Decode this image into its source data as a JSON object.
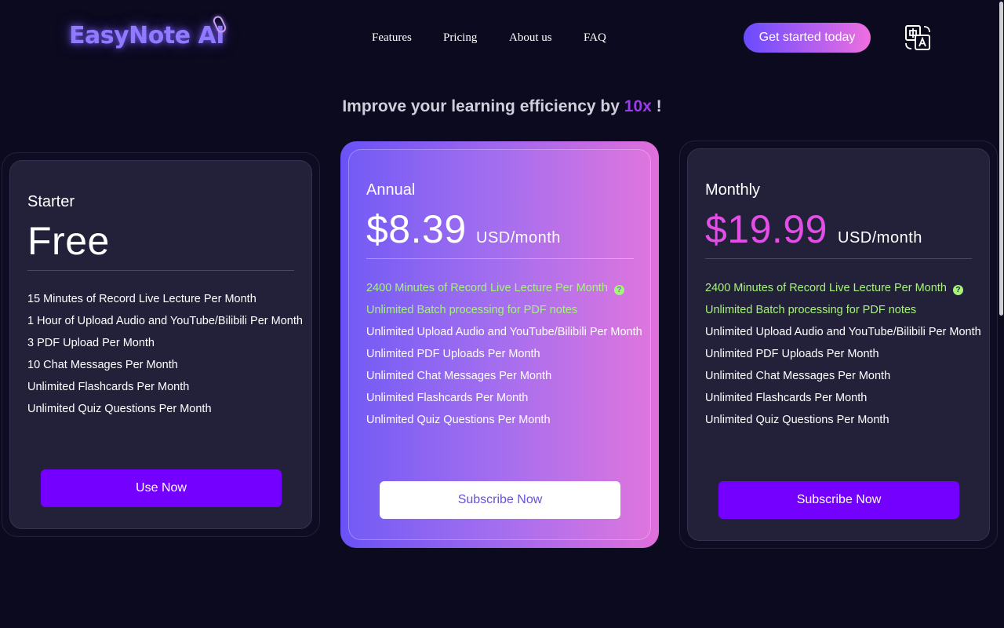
{
  "header": {
    "logo_text": "EasyNote AI",
    "nav": [
      {
        "label": "Features"
      },
      {
        "label": "Pricing"
      },
      {
        "label": "About us"
      },
      {
        "label": "FAQ"
      }
    ],
    "cta_label": "Get started today",
    "language_icon": "translate-icon"
  },
  "headline": {
    "prefix": "Improve your learning efficiency by ",
    "accent": "10x",
    "suffix": " !"
  },
  "plans": {
    "starter": {
      "name": "Starter",
      "price": "Free",
      "features": [
        "15 Minutes of Record Live Lecture Per Month",
        "1 Hour of Upload Audio and YouTube/Bilibili Per Month",
        "3 PDF Upload Per Month",
        "10 Chat Messages Per Month",
        "Unlimited Flashcards Per Month",
        "Unlimited Quiz Questions Per Month"
      ],
      "button": "Use Now"
    },
    "annual": {
      "name": "Annual",
      "price": "$8.39",
      "unit": "USD/month",
      "features": [
        "2400 Minutes of Record Live Lecture Per Month",
        "Unlimited Batch processing for PDF notes",
        "Unlimited Upload Audio and YouTube/Bilibili Per Month",
        "Unlimited PDF Uploads Per Month",
        "Unlimited Chat Messages Per Month",
        "Unlimited Flashcards Per Month",
        "Unlimited Quiz Questions Per Month"
      ],
      "help_icon": "?",
      "button": "Subscribe Now"
    },
    "monthly": {
      "name": "Monthly",
      "price": "$19.99",
      "unit": "USD/month",
      "features": [
        "2400 Minutes of Record Live Lecture Per Month",
        "Unlimited Batch processing for PDF notes",
        "Unlimited Upload Audio and YouTube/Bilibili Per Month",
        "Unlimited PDF Uploads Per Month",
        "Unlimited Chat Messages Per Month",
        "Unlimited Flashcards Per Month",
        "Unlimited Quiz Questions Per Month"
      ],
      "help_icon": "?",
      "button": "Subscribe Now"
    }
  },
  "colors": {
    "background": "#0b0a1e",
    "accent_purple": "#7400ff",
    "highlight_green": "#a6f27a",
    "price_pink": "#e24ee6"
  }
}
